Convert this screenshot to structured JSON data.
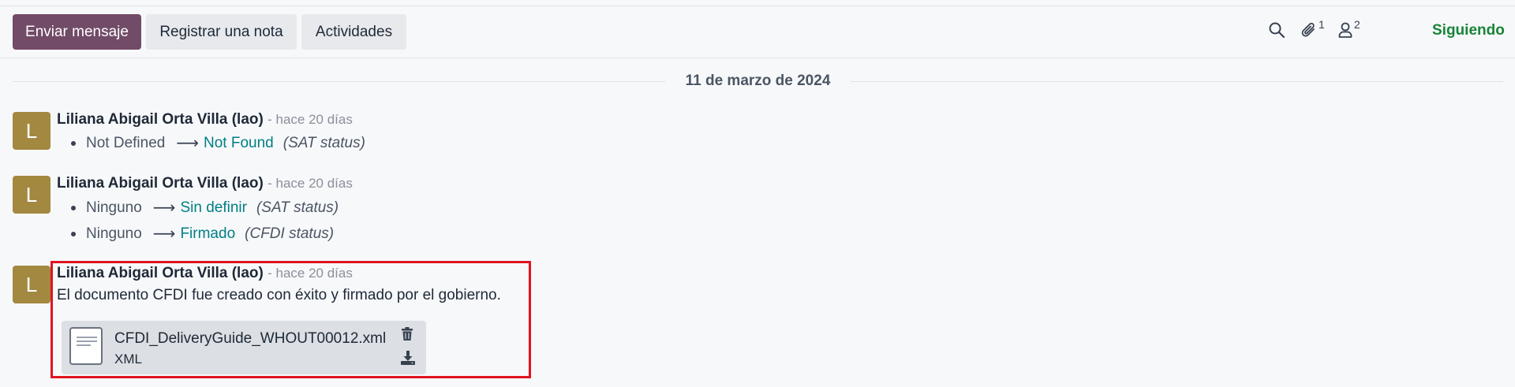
{
  "toolbar": {
    "send_message": "Enviar mensaje",
    "log_note": "Registrar una nota",
    "activities": "Actividades",
    "attachments_count": "1",
    "followers_count": "2",
    "following": "Siguiendo",
    "icons": [
      "search-icon",
      "paperclip-icon",
      "user-icon"
    ]
  },
  "date_separator": "11 de marzo de 2024",
  "messages": [
    {
      "avatar": "L",
      "author": "Liliana Abigail Orta Villa (lao)",
      "when": "- hace 20 días",
      "tracking": [
        {
          "old": "Not Defined",
          "arrow": "⟶",
          "new": "Not Found",
          "field": "(SAT status)"
        }
      ]
    },
    {
      "avatar": "L",
      "author": "Liliana Abigail Orta Villa (lao)",
      "when": "- hace 20 días",
      "tracking": [
        {
          "old": "Ninguno",
          "arrow": "⟶",
          "new": "Sin definir",
          "field": "(SAT status)"
        },
        {
          "old": "Ninguno",
          "arrow": "⟶",
          "new": "Firmado",
          "field": "(CFDI status)"
        }
      ]
    },
    {
      "avatar": "L",
      "author": "Liliana Abigail Orta Villa (lao)",
      "when": "- hace 20 días",
      "body": "El documento CFDI fue creado con éxito y firmado por el gobierno.",
      "attachment": {
        "name": "CFDI_DeliveryGuide_WHOUT00012.xml",
        "type": "XML"
      }
    }
  ],
  "colors": {
    "primary": "#714b67",
    "avatar": "#a38840",
    "tracking_new": "#017e84",
    "following": "#178537",
    "highlight": "#e0141e"
  }
}
